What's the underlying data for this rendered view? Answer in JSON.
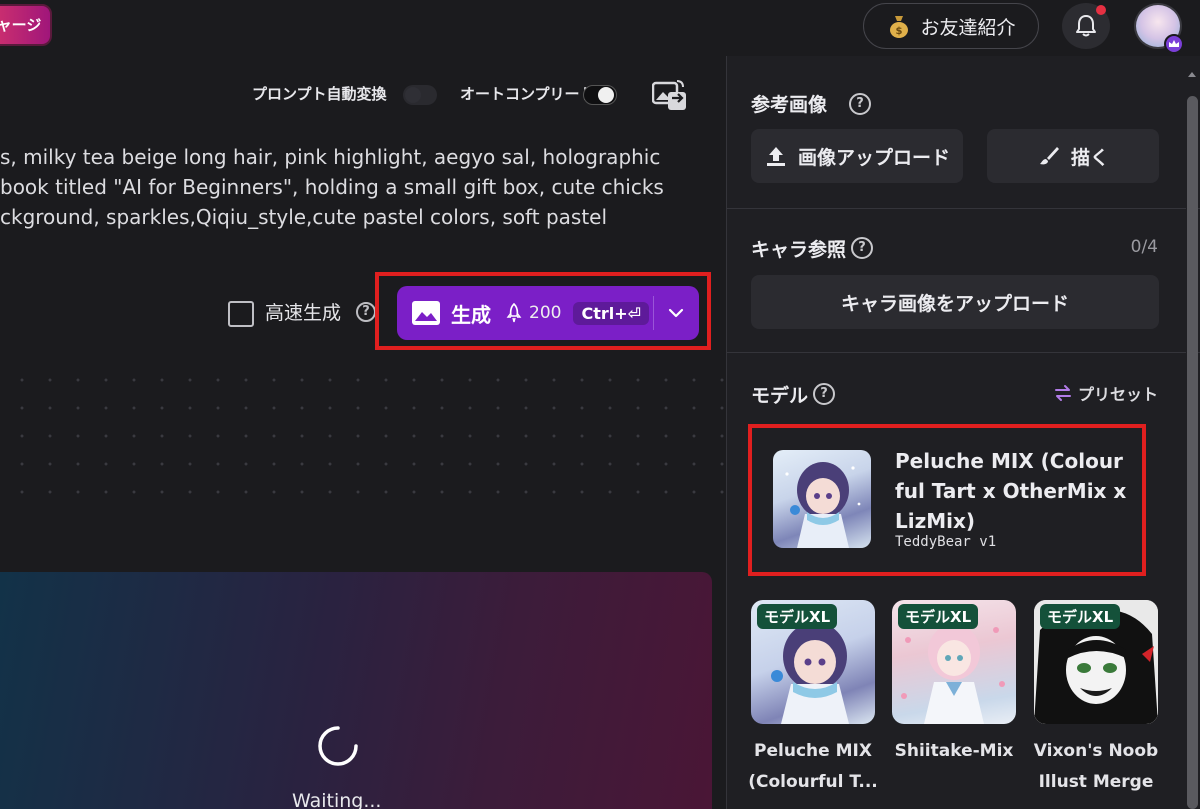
{
  "topbar": {
    "charge_label": "ャージ",
    "referral_label": "お友達紹介"
  },
  "toolbar": {
    "prompt_auto_convert_label": "プロンプト自動変換",
    "prompt_auto_convert_on": false,
    "autocomplete_label": "オートコンプリート",
    "autocomplete_on": true
  },
  "prompt": {
    "lines": [
      "s, milky tea beige long hair, pink highlight, aegyo sal, holographic",
      "book titled \"AI for Beginners\", holding a small gift box, cute chicks",
      "ckground, sparkles,Qiqiu_style,cute pastel colors, soft pastel"
    ]
  },
  "generate": {
    "fast_label": "高速生成",
    "fast_checked": false,
    "button_label": "生成",
    "cost": "200",
    "shortcut": "Ctrl+⏎"
  },
  "status": {
    "waiting": "Waiting..."
  },
  "panel": {
    "reference": {
      "title": "参考画像",
      "upload_label": "画像アップロード",
      "draw_label": "描く"
    },
    "character": {
      "title": "キャラ参照",
      "count": "0/4",
      "upload_label": "キャラ画像をアップロード"
    },
    "model": {
      "title": "モデル",
      "preset_label": "プリセット",
      "selected": {
        "name": "Peluche MIX (Colourful Tart x OtherMix x LizMix)",
        "version": "TeddyBear v1"
      },
      "options": [
        {
          "badge": "モデルXL",
          "name_line1": "Peluche MIX",
          "name_line2": "(Colourful T..."
        },
        {
          "badge": "モデルXL",
          "name_line1": "Shiitake-Mix",
          "name_line2": ""
        },
        {
          "badge": "モデルXL",
          "name_line1": "Vixon's Noob",
          "name_line2": "Illust Merge"
        }
      ]
    }
  },
  "colors": {
    "accent_purple": "#7b1fc7",
    "highlight_red": "#e01f1f",
    "badge_green": "#14513a"
  }
}
